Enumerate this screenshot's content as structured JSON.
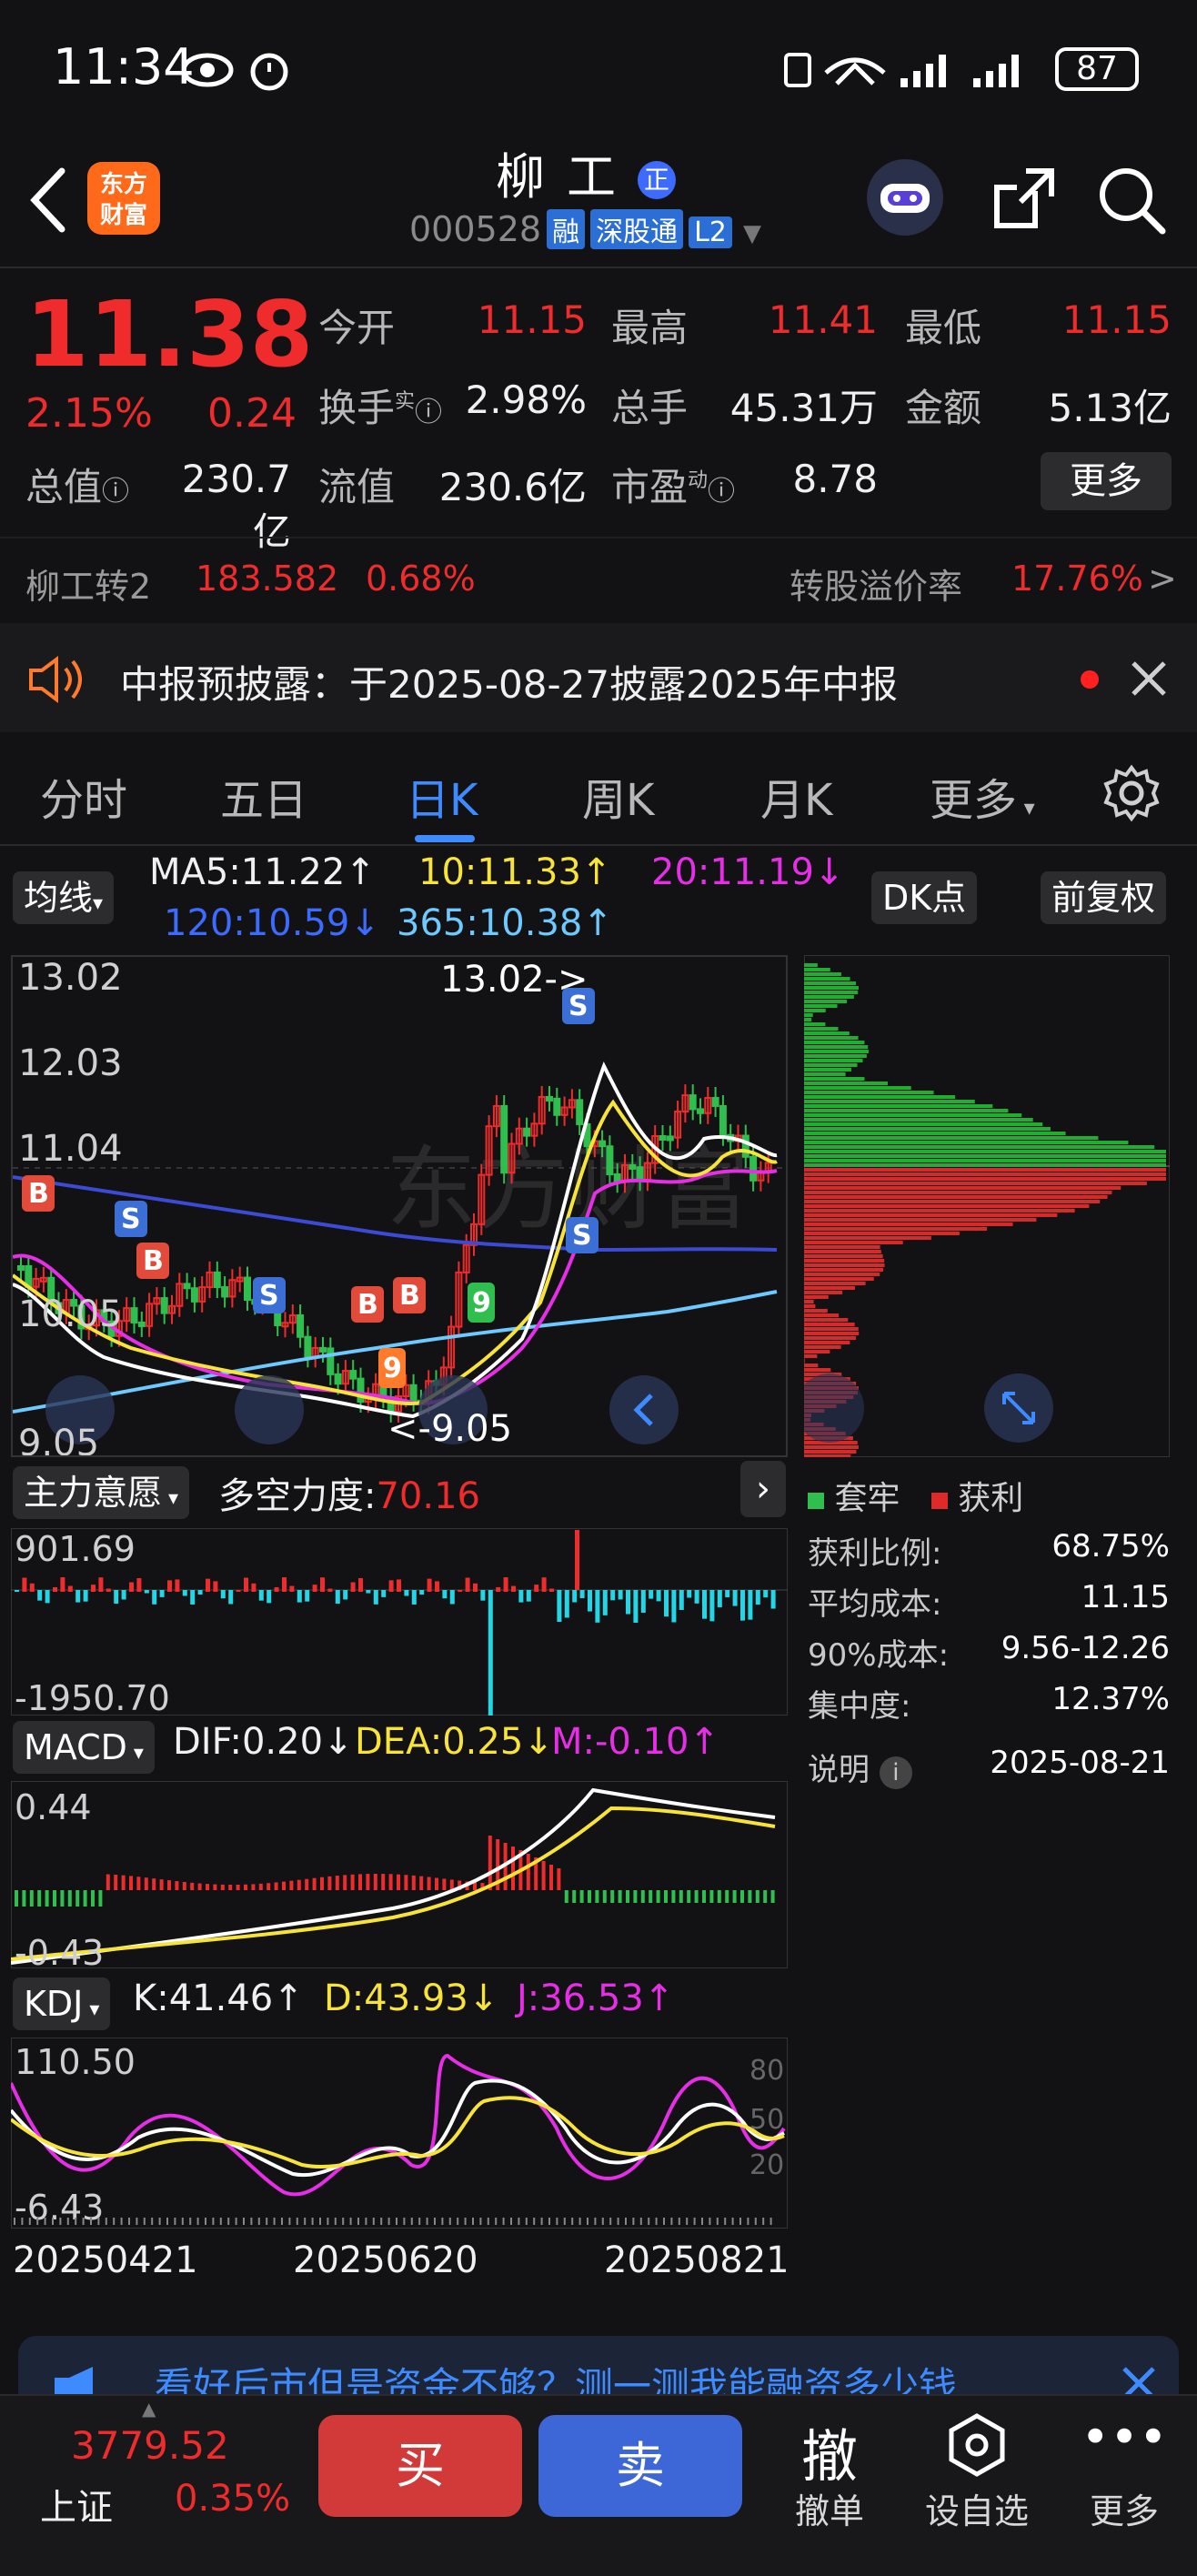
{
  "status": {
    "time": "11:34",
    "battery": "87"
  },
  "header": {
    "name": "柳工",
    "name_badge": "正",
    "code": "000528",
    "tags": [
      "融",
      "深股通",
      "L2"
    ],
    "logo_line1": "东方",
    "logo_line2": "财富"
  },
  "quote": {
    "price": "11.38",
    "change_pct": "2.15%",
    "change": "0.24",
    "open_label": "今开",
    "open": "11.15",
    "high_label": "最高",
    "high": "11.41",
    "low_label": "最低",
    "low": "11.15",
    "turnover_label": "换手",
    "turnover_sup": "实",
    "turnover": "2.98%",
    "volume_label": "总手",
    "volume": "45.31万",
    "amount_label": "金额",
    "amount": "5.13亿",
    "mktcap_label": "总值",
    "mktcap": "230.7亿",
    "float_label": "流值",
    "float": "230.6亿",
    "pe_label": "市盈",
    "pe_sup": "动",
    "pe": "8.78",
    "more_label": "更多"
  },
  "convert": {
    "name": "柳工转2",
    "price": "183.582",
    "pct": "0.68%",
    "premium_label": "转股溢价率",
    "premium": "17.76%",
    "arrow": ">"
  },
  "notice": {
    "text": "中报预披露：于2025-08-27披露2025年中报"
  },
  "tabs": {
    "t1": "分时",
    "t2": "五日",
    "t3": "日K",
    "t4": "周K",
    "t5": "月K",
    "t6": "更多"
  },
  "ma": {
    "selector": "均线",
    "ma5": "MA5:11.22↑",
    "ma10": "10:11.33↑",
    "ma20": "20:11.19↓",
    "ma120": "120:10.59↓",
    "ma365": "365:10.38↑",
    "dk": "DK点",
    "adjust": "前复权"
  },
  "kline": {
    "y_top": "13.02",
    "y_2": "12.03",
    "y_3": "11.04",
    "y_4": "10.05",
    "y_bot": "9.05",
    "peak_label": "13.02->",
    "trough_label": "<-9.05",
    "watermark": "东方财富"
  },
  "chip": {
    "legend_trap": "套牢",
    "legend_profit": "获利",
    "rows": [
      {
        "label": "获利比例:",
        "value": "68.75%"
      },
      {
        "label": "平均成本:",
        "value": "11.15"
      },
      {
        "label": "90%成本:",
        "value": "9.56-12.26"
      },
      {
        "label": "集中度:",
        "value": "12.37%"
      }
    ],
    "note_label": "说明",
    "date": "2025-08-21"
  },
  "flow": {
    "selector": "主力意愿",
    "label": "多空力度:",
    "value": "70.16",
    "top": "901.69",
    "bottom": "-1950.70"
  },
  "macd": {
    "selector": "MACD",
    "dif": "DIF:0.20↓",
    "dea": "DEA:0.25↓",
    "m": "M:-0.10↑",
    "top": "0.44",
    "bottom": "-0.43"
  },
  "kdj": {
    "selector": "KDJ",
    "k": "K:41.46↑",
    "d": "D:43.93↓",
    "j": "J:36.53↑",
    "top": "110.50",
    "bottom": "-6.43",
    "r80": "80",
    "r50": "50",
    "r20": "20"
  },
  "dates": {
    "d1": "20250421",
    "d2": "20250620",
    "d3": "20250821"
  },
  "banner": {
    "text": "看好后市但是资金不够？测一测我能融资多少钱"
  },
  "bottom": {
    "index_value": "3779.52",
    "index_name": "上证",
    "index_pct": "0.35%",
    "buy": "买",
    "sell": "卖",
    "cancel_icon": "撤",
    "cancel": "撤单",
    "watch": "设自选",
    "more": "更多"
  },
  "colors": {
    "up": "#ef2b2b",
    "down": "#2fbf4f",
    "accent": "#3d8bff",
    "bg": "#121214"
  }
}
